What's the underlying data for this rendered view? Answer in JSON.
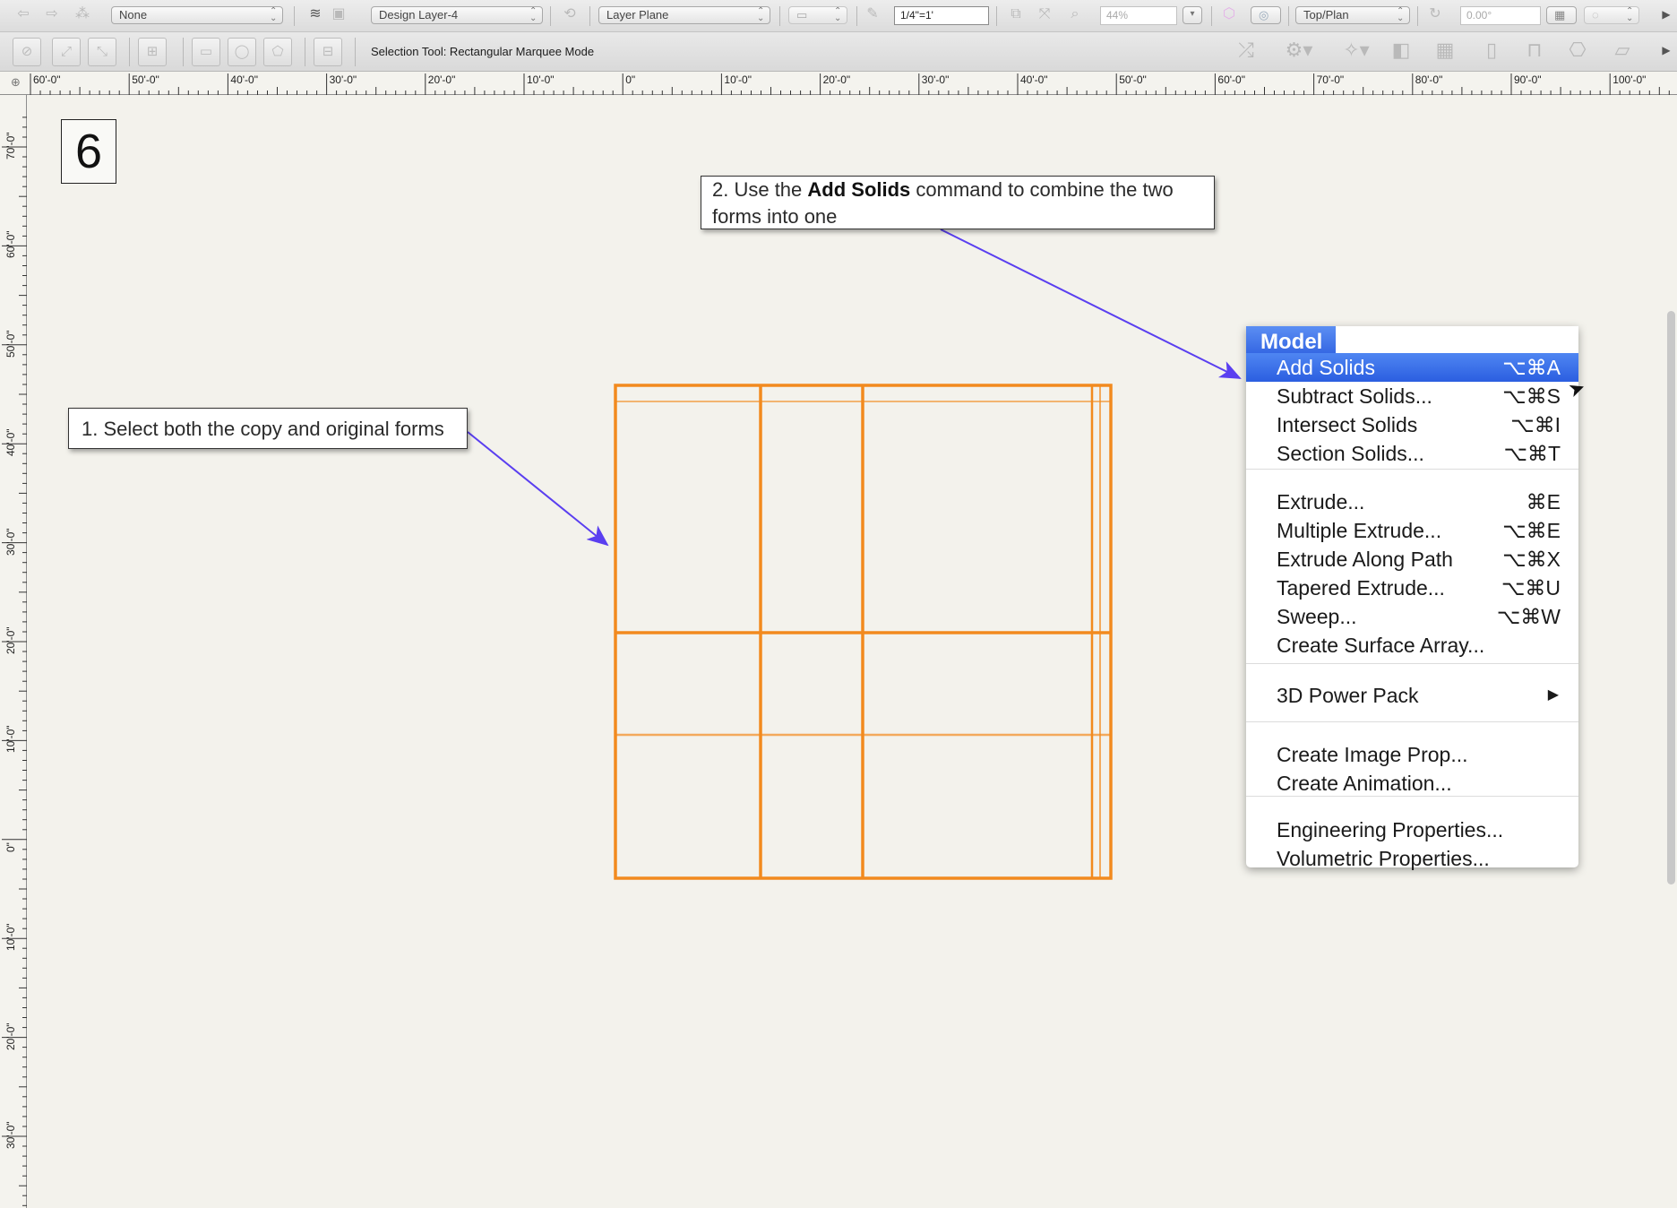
{
  "toolbar_top": {
    "class_select": "None",
    "layer_select": "Design Layer-4",
    "plane_select": "Layer Plane",
    "scale_value": "1/4\"=1'",
    "zoom_value": "44%",
    "view_select": "Top/Plan",
    "rotation_value": "0.00°"
  },
  "toolbar_mode": {
    "mode_label": "Selection Tool: Rectangular Marquee Mode"
  },
  "rulers": {
    "horizontal": [
      "60'-0\"",
      "50'-0\"",
      "40'-0\"",
      "30'-0\"",
      "20'-0\"",
      "10'-0\"",
      "0\"",
      "10'-0\"",
      "20'-0\"",
      "30'-0\"",
      "40'-0\"",
      "50'-0\"",
      "60'-0\"",
      "70'-0\"",
      "80'-0\"",
      "90'-0\"",
      "100'-0\""
    ],
    "vertical": [
      "70'-0\"",
      "60'-0\"",
      "50'-0\"",
      "40'-0\"",
      "30'-0\"",
      "20'-0\"",
      "10'-0\"",
      "0\"",
      "10'-0\"",
      "20'-0\"",
      "30'-0\""
    ]
  },
  "step": {
    "number": "6"
  },
  "callouts": {
    "first": "1. Select both the copy and original forms",
    "second_prefix": "2. Use the ",
    "second_bold": "Add Solids",
    "second_suffix": " command to combine the two forms into one"
  },
  "menu": {
    "title": "Model",
    "items": [
      {
        "label": "Add Solids",
        "shortcut": "⌥⌘A",
        "highlighted": true
      },
      {
        "label": "Subtract Solids...",
        "shortcut": "⌥⌘S"
      },
      {
        "label": "Intersect Solids",
        "shortcut": "⌥⌘I"
      },
      {
        "label": "Section Solids...",
        "shortcut": "⌥⌘T"
      },
      {
        "label": "Extrude...",
        "shortcut": "⌘E"
      },
      {
        "label": "Multiple Extrude...",
        "shortcut": "⌥⌘E"
      },
      {
        "label": "Extrude Along Path",
        "shortcut": "⌥⌘X"
      },
      {
        "label": "Tapered Extrude...",
        "shortcut": "⌥⌘U"
      },
      {
        "label": "Sweep...",
        "shortcut": "⌥⌘W"
      },
      {
        "label": "Create Surface Array...",
        "shortcut": ""
      },
      {
        "label": "3D Power Pack",
        "shortcut": "▶"
      },
      {
        "label": "Create Image Prop...",
        "shortcut": ""
      },
      {
        "label": "Create Animation...",
        "shortcut": ""
      },
      {
        "label": "Engineering Properties...",
        "shortcut": ""
      },
      {
        "label": "Volumetric Properties...",
        "shortcut": ""
      }
    ]
  },
  "colors": {
    "geometry": "#f28a1e",
    "arrow": "#5a3ff0",
    "menu_highlight": "#3a6ee8"
  }
}
